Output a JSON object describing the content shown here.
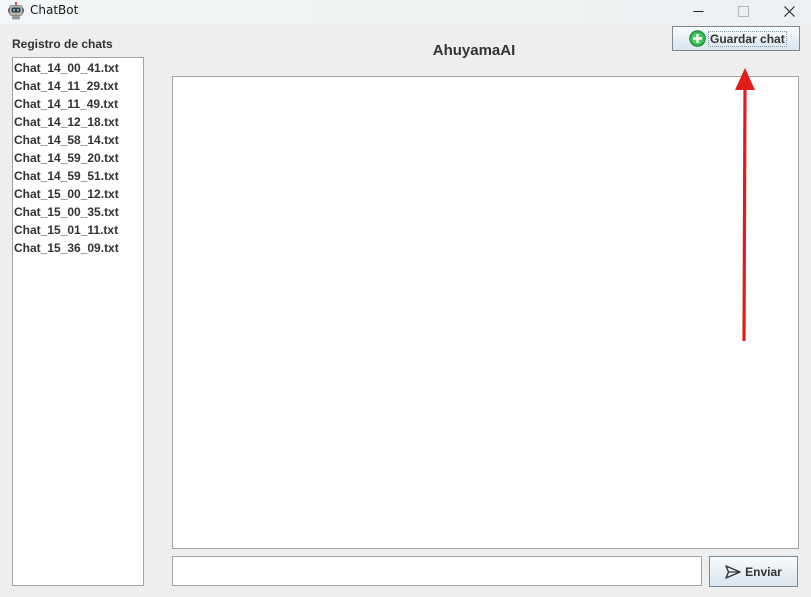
{
  "window": {
    "title": "ChatBot",
    "app_icon": "robot-icon",
    "controls": [
      "minimize-icon",
      "maximize-icon",
      "close-icon"
    ]
  },
  "sidebar": {
    "label": "Registro de chats",
    "items": [
      "Chat_14_00_41.txt",
      "Chat_14_11_29.txt",
      "Chat_14_11_49.txt",
      "Chat_14_12_18.txt",
      "Chat_14_58_14.txt",
      "Chat_14_59_20.txt",
      "Chat_14_59_51.txt",
      "Chat_15_00_12.txt",
      "Chat_15_00_35.txt",
      "Chat_15_01_11.txt",
      "Chat_15_36_09.txt"
    ]
  },
  "header": {
    "title": "AhuyamaAI",
    "save_label": "Guardar chat",
    "save_icon": "add-circle-icon"
  },
  "chat": {
    "messages": []
  },
  "composer": {
    "input_value": "",
    "send_label": "Enviar",
    "send_icon": "send-arrow-icon"
  },
  "annotation": {
    "type": "arrow",
    "color": "#e31b1b",
    "points_to": "save-button"
  },
  "colors": {
    "window_bg": "#eeeeee",
    "text": "#333333",
    "border": "#a3a3a3",
    "button_top": "#f8fbfd",
    "button_bottom": "#d9e5ef",
    "icon_green": "#2db34a"
  }
}
